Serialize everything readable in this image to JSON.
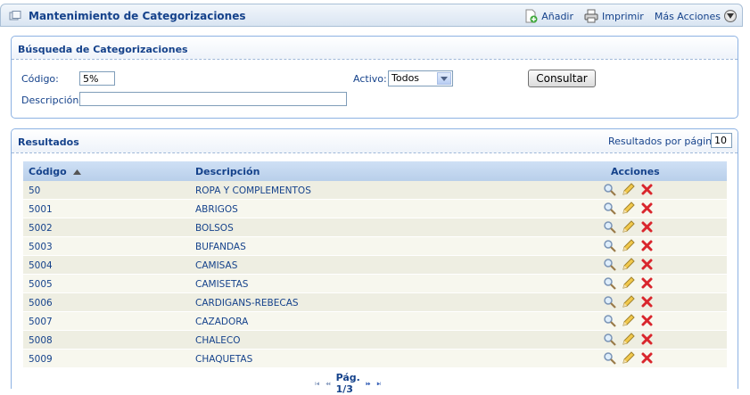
{
  "window": {
    "title": "Mantenimiento de Categorizaciones",
    "actions": {
      "add": "Añadir",
      "print": "Imprimir",
      "more": "Más Acciones"
    }
  },
  "search": {
    "title": "Búsqueda de Categorizaciones",
    "code_label": "Código:",
    "code_value": "5%",
    "description_label": "Descripción:",
    "description_value": "",
    "active_label": "Activo:",
    "active_value": "Todos",
    "submit_label": "Consultar"
  },
  "results": {
    "title": "Resultados",
    "per_page_label": "Resultados por página",
    "per_page_value": "10",
    "columns": {
      "code": "Código",
      "description": "Descripción",
      "actions": "Acciones"
    },
    "rows": [
      {
        "code": "50",
        "description": "ROPA Y COMPLEMENTOS"
      },
      {
        "code": "5001",
        "description": "ABRIGOS"
      },
      {
        "code": "5002",
        "description": "BOLSOS"
      },
      {
        "code": "5003",
        "description": "BUFANDAS"
      },
      {
        "code": "5004",
        "description": "CAMISAS"
      },
      {
        "code": "5005",
        "description": "CAMISETAS"
      },
      {
        "code": "5006",
        "description": "CARDIGANS-REBECAS"
      },
      {
        "code": "5007",
        "description": "CAZADORA"
      },
      {
        "code": "5008",
        "description": "CHALECO"
      },
      {
        "code": "5009",
        "description": "CHAQUETAS"
      }
    ],
    "row_actions": [
      "magnifier-icon",
      "pencil-icon",
      "delete-icon"
    ],
    "pager": {
      "text": "Pág. 1/3"
    }
  },
  "colors": {
    "accent": "#15428b",
    "header_bg": "#cfe0f5",
    "row_odd": "#eeeee2",
    "row_even": "#f7f7ee",
    "delete": "#d9262d"
  }
}
